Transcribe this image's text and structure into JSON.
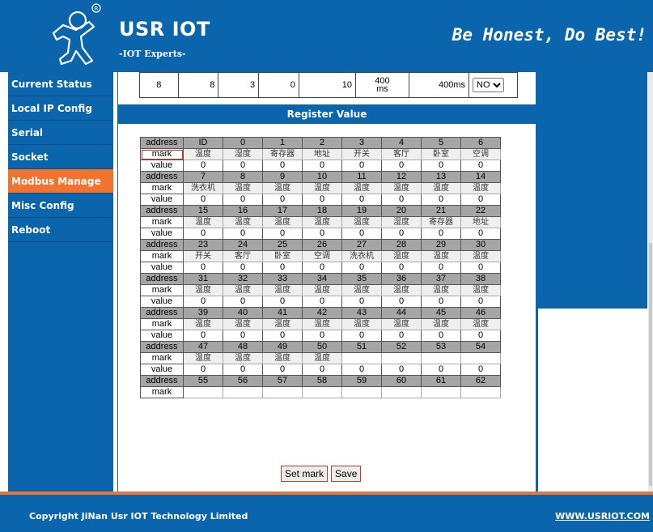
{
  "header": {
    "brand": "USR IOT",
    "sub_brand": "-IOT Experts-",
    "slogan": "Be Honest, Do Best!",
    "logo_icon": "running-person-logo-icon",
    "brand_color": "#0a65ad",
    "accent_color": "#f0742f"
  },
  "sidebar": {
    "items": [
      {
        "label": "Current Status",
        "active": false
      },
      {
        "label": "Local IP Config",
        "active": false
      },
      {
        "label": "Serial",
        "active": false
      },
      {
        "label": "Socket",
        "active": false
      },
      {
        "label": "Modbus Manage",
        "active": true
      },
      {
        "label": "Misc Config",
        "active": false
      },
      {
        "label": "Reboot",
        "active": false
      }
    ]
  },
  "top_row": {
    "cells": [
      "8",
      "8",
      "3",
      "0",
      "10"
    ],
    "timeout_line1": "400",
    "timeout_line2": "ms",
    "timeout2": "400ms",
    "select_value": "NO"
  },
  "section_title": "Register Value",
  "register": {
    "labels": {
      "address": "address",
      "mark": "mark",
      "value": "value"
    },
    "blocks": [
      {
        "addresses": [
          "ID",
          "0",
          "1",
          "2",
          "3",
          "4",
          "5",
          "6"
        ],
        "marks": [
          "温度",
          "湿度",
          "寄存器",
          "地址",
          "开关",
          "客厅",
          "卧室",
          "空调"
        ],
        "values": [
          "0",
          "0",
          "0",
          "0",
          "0",
          "0",
          "0",
          "0"
        ]
      },
      {
        "addresses": [
          "7",
          "8",
          "9",
          "10",
          "11",
          "12",
          "13",
          "14"
        ],
        "marks": [
          "洗衣机",
          "温度",
          "温度",
          "温度",
          "温度",
          "温度",
          "温度",
          "温度"
        ],
        "values": [
          "0",
          "0",
          "0",
          "0",
          "0",
          "0",
          "0",
          "0"
        ]
      },
      {
        "addresses": [
          "15",
          "16",
          "17",
          "18",
          "19",
          "20",
          "21",
          "22"
        ],
        "marks": [
          "温度",
          "温度",
          "温度",
          "温度",
          "温度",
          "湿度",
          "寄存器",
          "地址"
        ],
        "values": [
          "0",
          "0",
          "0",
          "0",
          "0",
          "0",
          "0",
          "0"
        ]
      },
      {
        "addresses": [
          "23",
          "24",
          "25",
          "26",
          "27",
          "28",
          "29",
          "30"
        ],
        "marks": [
          "开关",
          "客厅",
          "卧室",
          "空调",
          "洗衣机",
          "温度",
          "温度",
          "温度"
        ],
        "values": [
          "0",
          "0",
          "0",
          "0",
          "0",
          "0",
          "0",
          "0"
        ]
      },
      {
        "addresses": [
          "31",
          "32",
          "33",
          "34",
          "35",
          "36",
          "37",
          "38"
        ],
        "marks": [
          "温度",
          "温度",
          "温度",
          "温度",
          "温度",
          "温度",
          "温度",
          "温度"
        ],
        "values": [
          "0",
          "0",
          "0",
          "0",
          "0",
          "0",
          "0",
          "0"
        ]
      },
      {
        "addresses": [
          "39",
          "40",
          "41",
          "42",
          "43",
          "44",
          "45",
          "46"
        ],
        "marks": [
          "温度",
          "温度",
          "温度",
          "温度",
          "温度",
          "温度",
          "温度",
          "温度"
        ],
        "values": [
          "0",
          "0",
          "0",
          "0",
          "0",
          "0",
          "0",
          "0"
        ]
      },
      {
        "addresses": [
          "47",
          "48",
          "49",
          "50",
          "51",
          "52",
          "53",
          "54"
        ],
        "marks": [
          "温度",
          "温度",
          "温度",
          "温度",
          "",
          "",
          "",
          ""
        ],
        "values": [
          "0",
          "0",
          "0",
          "0",
          "0",
          "0",
          "0",
          "0"
        ]
      },
      {
        "addresses": [
          "55",
          "56",
          "57",
          "58",
          "59",
          "60",
          "61",
          "62"
        ],
        "marks": [
          "",
          "",
          "",
          "",
          "",
          "",
          "",
          ""
        ],
        "values": null
      }
    ]
  },
  "buttons": {
    "set_mark": "Set mark",
    "save": "Save"
  },
  "footer": {
    "copyright": "Copyright JiNan Usr IOT Technology Limited",
    "website": "WWW.USRIOT.COM"
  }
}
